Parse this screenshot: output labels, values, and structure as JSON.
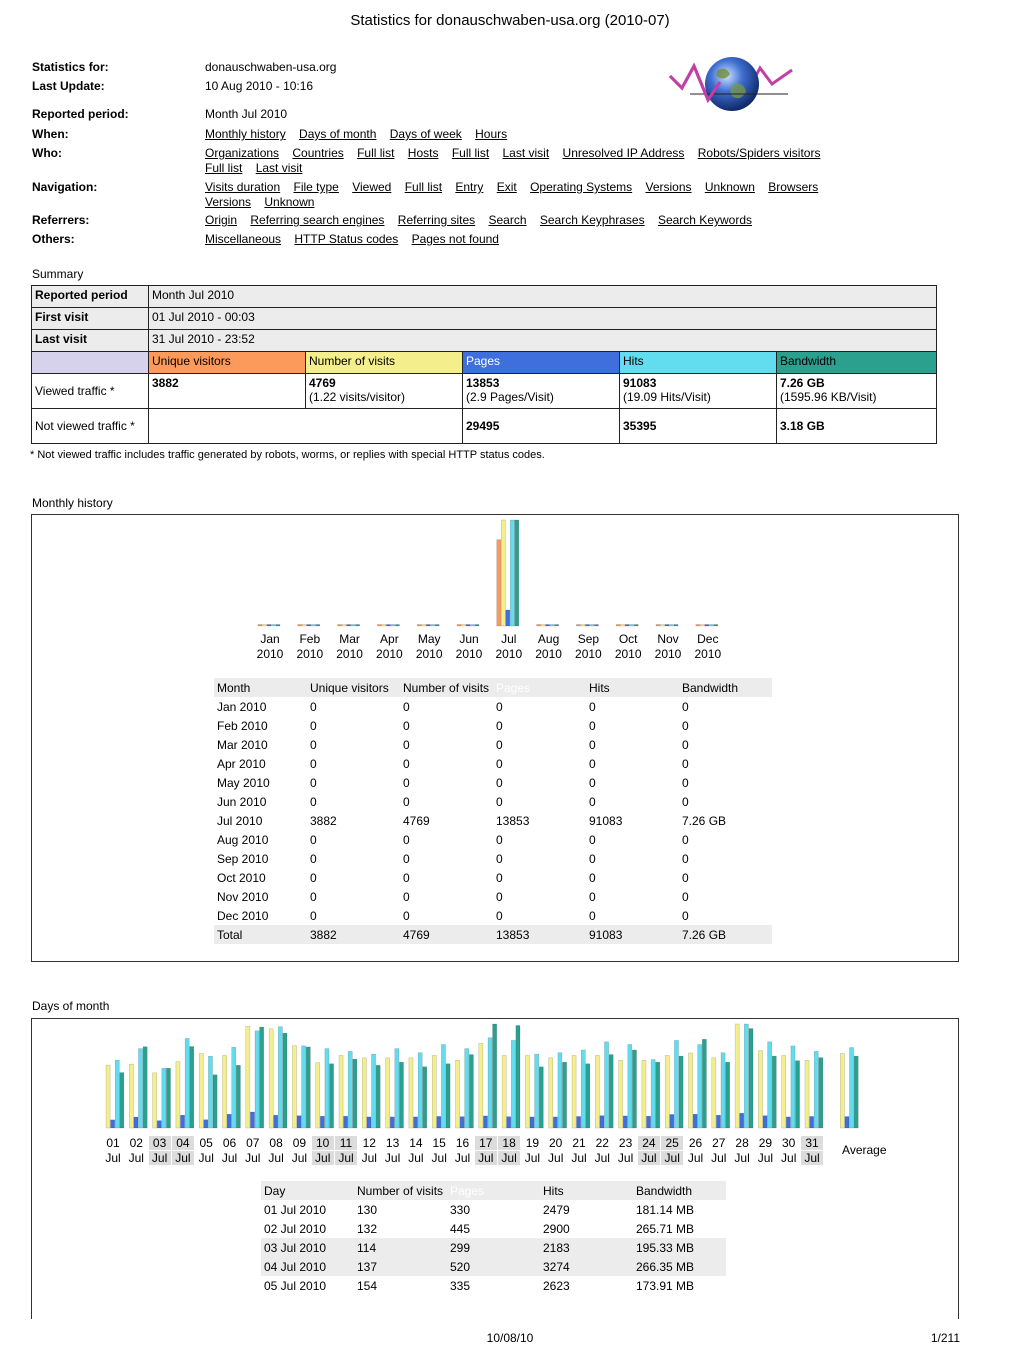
{
  "page_title": "Statistics for donauschwaben-usa.org (2010-07)",
  "info": {
    "stats_for_label": "Statistics for:",
    "stats_for_value": "donauschwaben-usa.org",
    "last_update_label": "Last Update:",
    "last_update_value": "10 Aug 2010 - 10:16",
    "reported_period_label": "Reported period:",
    "reported_period_value": "Month Jul 2010",
    "when_label": "When:",
    "when_links": [
      "Monthly history",
      "Days of month",
      "Days of week",
      "Hours"
    ],
    "who_label": "Who:",
    "who_links": [
      "Organizations",
      "Countries",
      "Full list",
      "Hosts",
      "Full list",
      "Last visit",
      "Unresolved IP Address",
      "Robots/Spiders visitors",
      "Full list",
      "Last visit"
    ],
    "navigation_label": "Navigation:",
    "navigation_links": [
      "Visits duration",
      "File type",
      "Viewed",
      "Full list",
      "Entry",
      "Exit",
      "Operating Systems",
      "Versions",
      "Unknown",
      "Browsers",
      "Versions",
      "Unknown"
    ],
    "referrers_label": "Referrers:",
    "referrers_links": [
      "Origin",
      "Referring search engines",
      "Referring sites",
      "Search",
      "Search Keyphrases",
      "Search Keywords"
    ],
    "others_label": "Others:",
    "others_links": [
      "Miscellaneous",
      "HTTP Status codes",
      "Pages not found"
    ]
  },
  "summary": {
    "title": "Summary",
    "reported_period_label": "Reported period",
    "reported_period_value": "Month Jul 2010",
    "first_visit_label": "First visit",
    "first_visit_value": "01 Jul 2010 - 00:03",
    "last_visit_label": "Last visit",
    "last_visit_value": "31 Jul 2010 - 23:52",
    "headers": [
      "Unique visitors",
      "Number of visits",
      "Pages",
      "Hits",
      "Bandwidth"
    ],
    "viewed_label": "Viewed traffic *",
    "viewed": {
      "unique": "3882",
      "visits": "4769",
      "visits_sub": "(1.22 visits/visitor)",
      "pages": "13853",
      "pages_sub": "(2.9 Pages/Visit)",
      "hits": "91083",
      "hits_sub": "(19.09 Hits/Visit)",
      "bandwidth": "7.26 GB",
      "bandwidth_sub": "(1595.96 KB/Visit)"
    },
    "not_viewed_label": "Not viewed traffic *",
    "not_viewed": {
      "pages": "29495",
      "hits": "35395",
      "bandwidth": "3.18 GB"
    },
    "footnote": "* Not viewed traffic includes traffic generated by robots, worms, or replies with special HTTP status codes."
  },
  "colors": {
    "unique_visitors": "#fb9a5a",
    "visits": "#f4ef8c",
    "pages": "#3f6fdc",
    "hits": "#62dcef",
    "bandwidth": "#2ca08f"
  },
  "monthly": {
    "title": "Monthly history",
    "headers": [
      "Month",
      "Unique visitors",
      "Number of visits",
      "Pages",
      "Hits",
      "Bandwidth"
    ],
    "rows": [
      [
        "Jan 2010",
        "0",
        "0",
        "0",
        "0",
        "0"
      ],
      [
        "Feb 2010",
        "0",
        "0",
        "0",
        "0",
        "0"
      ],
      [
        "Mar 2010",
        "0",
        "0",
        "0",
        "0",
        "0"
      ],
      [
        "Apr 2010",
        "0",
        "0",
        "0",
        "0",
        "0"
      ],
      [
        "May 2010",
        "0",
        "0",
        "0",
        "0",
        "0"
      ],
      [
        "Jun 2010",
        "0",
        "0",
        "0",
        "0",
        "0"
      ],
      [
        "Jul 2010",
        "3882",
        "4769",
        "13853",
        "91083",
        "7.26 GB"
      ],
      [
        "Aug 2010",
        "0",
        "0",
        "0",
        "0",
        "0"
      ],
      [
        "Sep 2010",
        "0",
        "0",
        "0",
        "0",
        "0"
      ],
      [
        "Oct 2010",
        "0",
        "0",
        "0",
        "0",
        "0"
      ],
      [
        "Nov 2010",
        "0",
        "0",
        "0",
        "0",
        "0"
      ],
      [
        "Dec 2010",
        "0",
        "0",
        "0",
        "0",
        "0"
      ]
    ],
    "total": [
      "Total",
      "3882",
      "4769",
      "13853",
      "91083",
      "7.26 GB"
    ]
  },
  "days": {
    "title": "Days of month",
    "average_label": "Average",
    "headers": [
      "Day",
      "Number of visits",
      "Pages",
      "Hits",
      "Bandwidth"
    ],
    "rows": [
      [
        "01 Jul 2010",
        "130",
        "330",
        "2479",
        "181.14 MB"
      ],
      [
        "02 Jul 2010",
        "132",
        "445",
        "2900",
        "265.71 MB"
      ],
      [
        "03 Jul 2010",
        "114",
        "299",
        "2183",
        "195.33 MB"
      ],
      [
        "04 Jul 2010",
        "137",
        "520",
        "3274",
        "266.35 MB"
      ],
      [
        "05 Jul 2010",
        "154",
        "335",
        "2623",
        "173.91 MB"
      ]
    ]
  },
  "chart_data": [
    {
      "type": "bar",
      "categories": [
        "Jan 2010",
        "Feb 2010",
        "Mar 2010",
        "Apr 2010",
        "May 2010",
        "Jun 2010",
        "Jul 2010",
        "Aug 2010",
        "Sep 2010",
        "Oct 2010",
        "Nov 2010",
        "Dec 2010"
      ],
      "tick_top": [
        "Jan",
        "Feb",
        "Mar",
        "Apr",
        "May",
        "Jun",
        "Jul",
        "Aug",
        "Sep",
        "Oct",
        "Nov",
        "Dec"
      ],
      "tick_bottom": [
        "2010",
        "2010",
        "2010",
        "2010",
        "2010",
        "2010",
        "2010",
        "2010",
        "2010",
        "2010",
        "2010",
        "2010"
      ],
      "series": [
        {
          "name": "Unique visitors",
          "values": [
            0,
            0,
            0,
            0,
            0,
            0,
            3882,
            0,
            0,
            0,
            0,
            0
          ]
        },
        {
          "name": "Number of visits",
          "values": [
            0,
            0,
            0,
            0,
            0,
            0,
            4769,
            0,
            0,
            0,
            0,
            0
          ]
        },
        {
          "name": "Pages",
          "values": [
            0,
            0,
            0,
            0,
            0,
            0,
            13853,
            0,
            0,
            0,
            0,
            0
          ]
        },
        {
          "name": "Hits",
          "values": [
            0,
            0,
            0,
            0,
            0,
            0,
            91083,
            0,
            0,
            0,
            0,
            0
          ]
        },
        {
          "name": "Bandwidth",
          "values": [
            0,
            0,
            0,
            0,
            0,
            0,
            7.26,
            0,
            0,
            0,
            0,
            0
          ]
        }
      ]
    },
    {
      "type": "bar",
      "categories": [
        "01",
        "02",
        "03",
        "04",
        "05",
        "06",
        "07",
        "08",
        "09",
        "10",
        "11",
        "12",
        "13",
        "14",
        "15",
        "16",
        "17",
        "18",
        "19",
        "20",
        "21",
        "22",
        "23",
        "24",
        "25",
        "26",
        "27",
        "28",
        "29",
        "30",
        "31",
        "Average"
      ],
      "tick_bottom": "Jul",
      "weekend_days": [
        "03",
        "04",
        "10",
        "11",
        "17",
        "18",
        "24",
        "25",
        "31"
      ],
      "series": [
        {
          "name": "Number of visits",
          "values": [
            130,
            132,
            114,
            137,
            154,
            150,
            210,
            205,
            170,
            135,
            150,
            145,
            145,
            145,
            150,
            140,
            175,
            150,
            150,
            145,
            150,
            150,
            140,
            140,
            150,
            155,
            145,
            215,
            160,
            150,
            140,
            154
          ]
        },
        {
          "name": "Pages",
          "values": [
            330,
            445,
            299,
            520,
            335,
            560,
            650,
            520,
            500,
            480,
            480,
            450,
            450,
            450,
            470,
            460,
            490,
            460,
            450,
            450,
            470,
            500,
            490,
            480,
            550,
            560,
            520,
            600,
            500,
            450,
            470,
            465
          ]
        },
        {
          "name": "Hits",
          "values": [
            2479,
            2900,
            2183,
            3274,
            2623,
            2950,
            3550,
            3700,
            3000,
            2900,
            2800,
            2700,
            2900,
            2750,
            3050,
            2900,
            3300,
            3200,
            2700,
            2750,
            2850,
            3150,
            3050,
            2500,
            3200,
            3050,
            2750,
            3800,
            3150,
            3000,
            2800,
            2940
          ]
        },
        {
          "name": "Bandwidth",
          "values": [
            181.14,
            265.71,
            195.33,
            266.35,
            173.91,
            205,
            330,
            310,
            265,
            210,
            225,
            205,
            215,
            200,
            210,
            240,
            340,
            335,
            200,
            215,
            210,
            240,
            255,
            215,
            235,
            290,
            215,
            325,
            235,
            220,
            230,
            235
          ]
        }
      ]
    }
  ]
}
